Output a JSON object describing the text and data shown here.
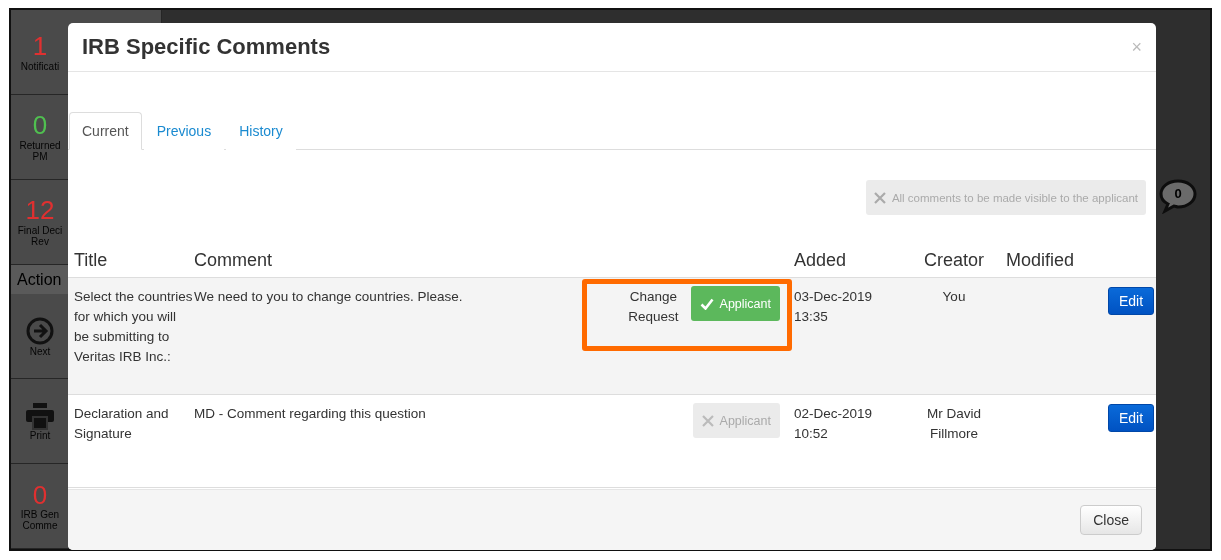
{
  "background": {
    "sidebar": [
      {
        "kind": "count",
        "value": "1",
        "color": "#e03030",
        "label": [
          "Notificati"
        ]
      },
      {
        "kind": "count",
        "value": "0",
        "color": "#50c050",
        "label": [
          "Returned",
          "PM"
        ]
      },
      {
        "kind": "count",
        "value": "12",
        "color": "#e03030",
        "label": [
          "Final Deci",
          "Rev"
        ]
      },
      {
        "kind": "heading",
        "label": [
          "Action"
        ]
      },
      {
        "kind": "next",
        "label": [
          "Next"
        ]
      },
      {
        "kind": "print",
        "label": [
          "Print"
        ]
      },
      {
        "kind": "count",
        "value": "0",
        "color": "#e03030",
        "label": [
          "IRB Gen",
          "Comme"
        ]
      }
    ],
    "bubble_count": "0"
  },
  "modal": {
    "title": "IRB Specific Comments",
    "close_symbol": "×",
    "tabs": [
      {
        "label": "Current",
        "selected": true
      },
      {
        "label": "Previous",
        "selected": false
      },
      {
        "label": "History",
        "selected": false
      }
    ],
    "visibility_toggle": {
      "label": "All comments to be made visible to the applicant",
      "on": false
    },
    "columns": [
      "Title",
      "Comment",
      "Added",
      "Creator",
      "Modified"
    ],
    "rows": [
      {
        "title": "Select the countries for which you will be submitting to Veritas IRB Inc.:",
        "comment": "We need to you to change countries. Please.",
        "type": [
          "Change",
          "Request"
        ],
        "applicant": {
          "label": "Applicant",
          "on": true
        },
        "added": [
          "03-Dec-2019",
          "13:35"
        ],
        "creator": [
          "You"
        ],
        "edit": "Edit",
        "highlighted": true
      },
      {
        "title": "Declaration and Signature",
        "comment": "MD - Comment regarding this question",
        "type": [],
        "applicant": {
          "label": "Applicant",
          "on": false
        },
        "added": [
          "02-Dec-2019",
          "10:52"
        ],
        "creator": [
          "Mr David",
          "Fillmore"
        ],
        "edit": "Edit",
        "highlighted": false
      }
    ],
    "footer_button": "Close"
  }
}
